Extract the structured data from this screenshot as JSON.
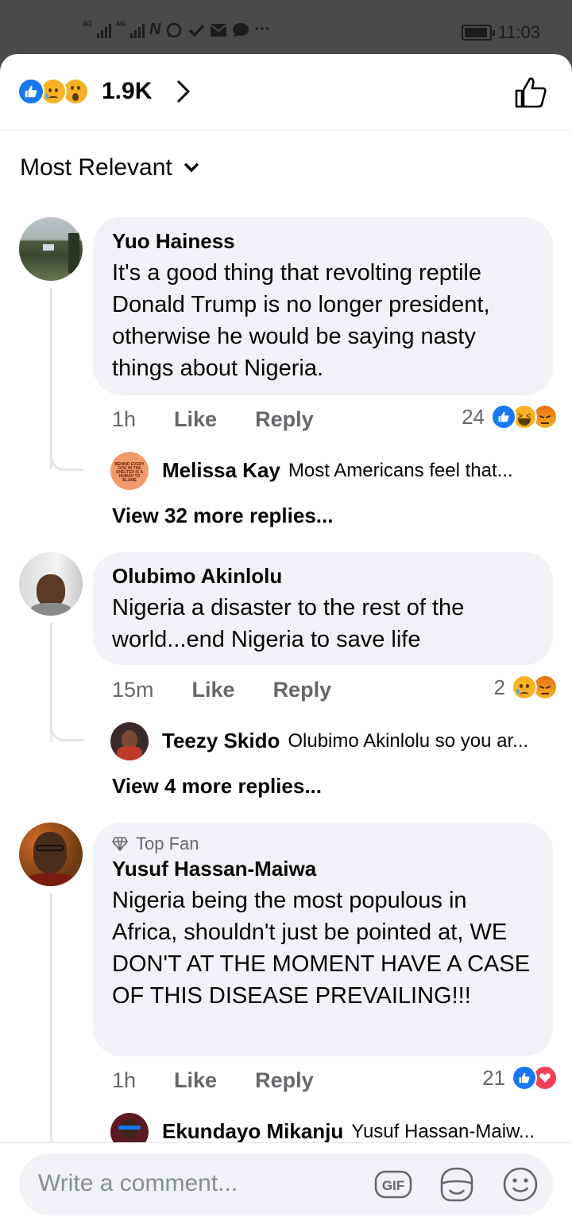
{
  "status_bar": {
    "net1": "4G",
    "net2": "4G",
    "time": "11:03"
  },
  "header": {
    "reaction_icons": [
      "like-icon",
      "sad-icon",
      "wow-icon"
    ],
    "reaction_count": "1.9K"
  },
  "sort": {
    "label": "Most Relevant"
  },
  "comments": [
    {
      "author": "Yuo Hainess",
      "text": "It's a good thing that revolting reptile Donald Trump is no longer president, otherwise he would be saying nasty things about Nigeria.",
      "time": "1h",
      "like": "Like",
      "reply": "Reply",
      "reaction_count": "24",
      "reaction_icons": [
        "like-icon",
        "haha-icon",
        "angry-icon"
      ],
      "reply_preview": {
        "author": "Melissa Kay",
        "text": "Most Americans feel that..."
      },
      "more_replies": "View 32 more replies..."
    },
    {
      "author": "Olubimo Akinlolu",
      "text": "Nigeria a disaster to the rest of the world...end Nigeria to save life",
      "time": "15m",
      "like": "Like",
      "reply": "Reply",
      "reaction_count": "2",
      "reaction_icons": [
        "sad-icon",
        "angry-icon"
      ],
      "reply_preview": {
        "author": "Teezy Skido",
        "text": "Olubimo Akinlolu so you ar..."
      },
      "more_replies": "View 4 more replies..."
    },
    {
      "badge": "Top Fan",
      "author": "Yusuf Hassan-Maiwa",
      "text": "Nigeria being the most populous in Africa, shouldn't just be pointed at, WE DON'T AT THE MOMENT HAVE A CASE OF THIS DISEASE PREVAILING!!!",
      "time": "1h",
      "like": "Like",
      "reply": "Reply",
      "reaction_count": "21",
      "reaction_icons": [
        "like-icon",
        "love-icon"
      ],
      "reply_preview": {
        "author": "Ekundayo Mikanju",
        "text": "Yusuf Hassan-Maiw..."
      }
    }
  ],
  "composer": {
    "placeholder": "Write a comment...",
    "gif_label": "GIF"
  },
  "colors": {
    "like_blue": "#1877f2",
    "bubble_gray": "#f0f2f5",
    "meta_gray": "#65676b",
    "love_red": "#f33e58",
    "emoji_yellow": "#f7b125"
  }
}
